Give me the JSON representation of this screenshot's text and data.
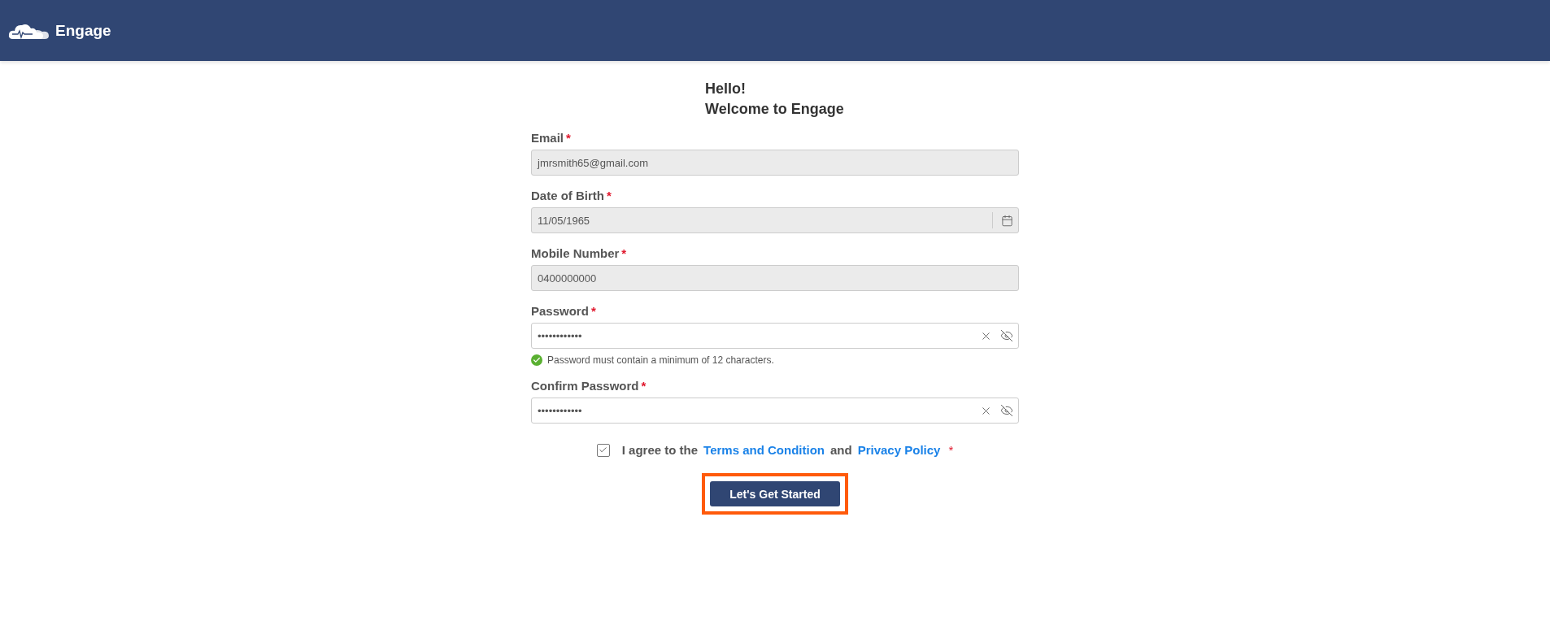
{
  "header": {
    "brand": "Engage"
  },
  "greeting": {
    "line_1": "Hello!",
    "line_2": "Welcome to Engage"
  },
  "fields": [
    {
      "kind": "text",
      "label": "Email",
      "required_mark": "*",
      "value": "jmrsmith65@gmail.com",
      "disabled": true
    },
    {
      "kind": "date",
      "label": "Date of Birth",
      "required_mark": "*",
      "value": "11/05/1965",
      "disabled": true
    },
    {
      "kind": "text",
      "label": "Mobile Number",
      "required_mark": "*",
      "value": "0400000000",
      "disabled": true
    },
    {
      "kind": "password",
      "label": "Password",
      "required_mark": "*",
      "value": "••••••••••••",
      "disabled": false,
      "hint": {
        "text": "Password must contain a minimum of 12 characters.",
        "met": true
      }
    },
    {
      "kind": "password",
      "label": "Confirm Password",
      "required_mark": "*",
      "value": "••••••••••••",
      "disabled": false
    }
  ],
  "agreement": {
    "checked": true,
    "text_1": "I agree to the",
    "link_1": "Terms and Condition",
    "text_2": "and",
    "link_2": "Privacy Policy",
    "required_mark": "*"
  },
  "submit": {
    "label": "Let's Get Started",
    "highlighted": true
  }
}
